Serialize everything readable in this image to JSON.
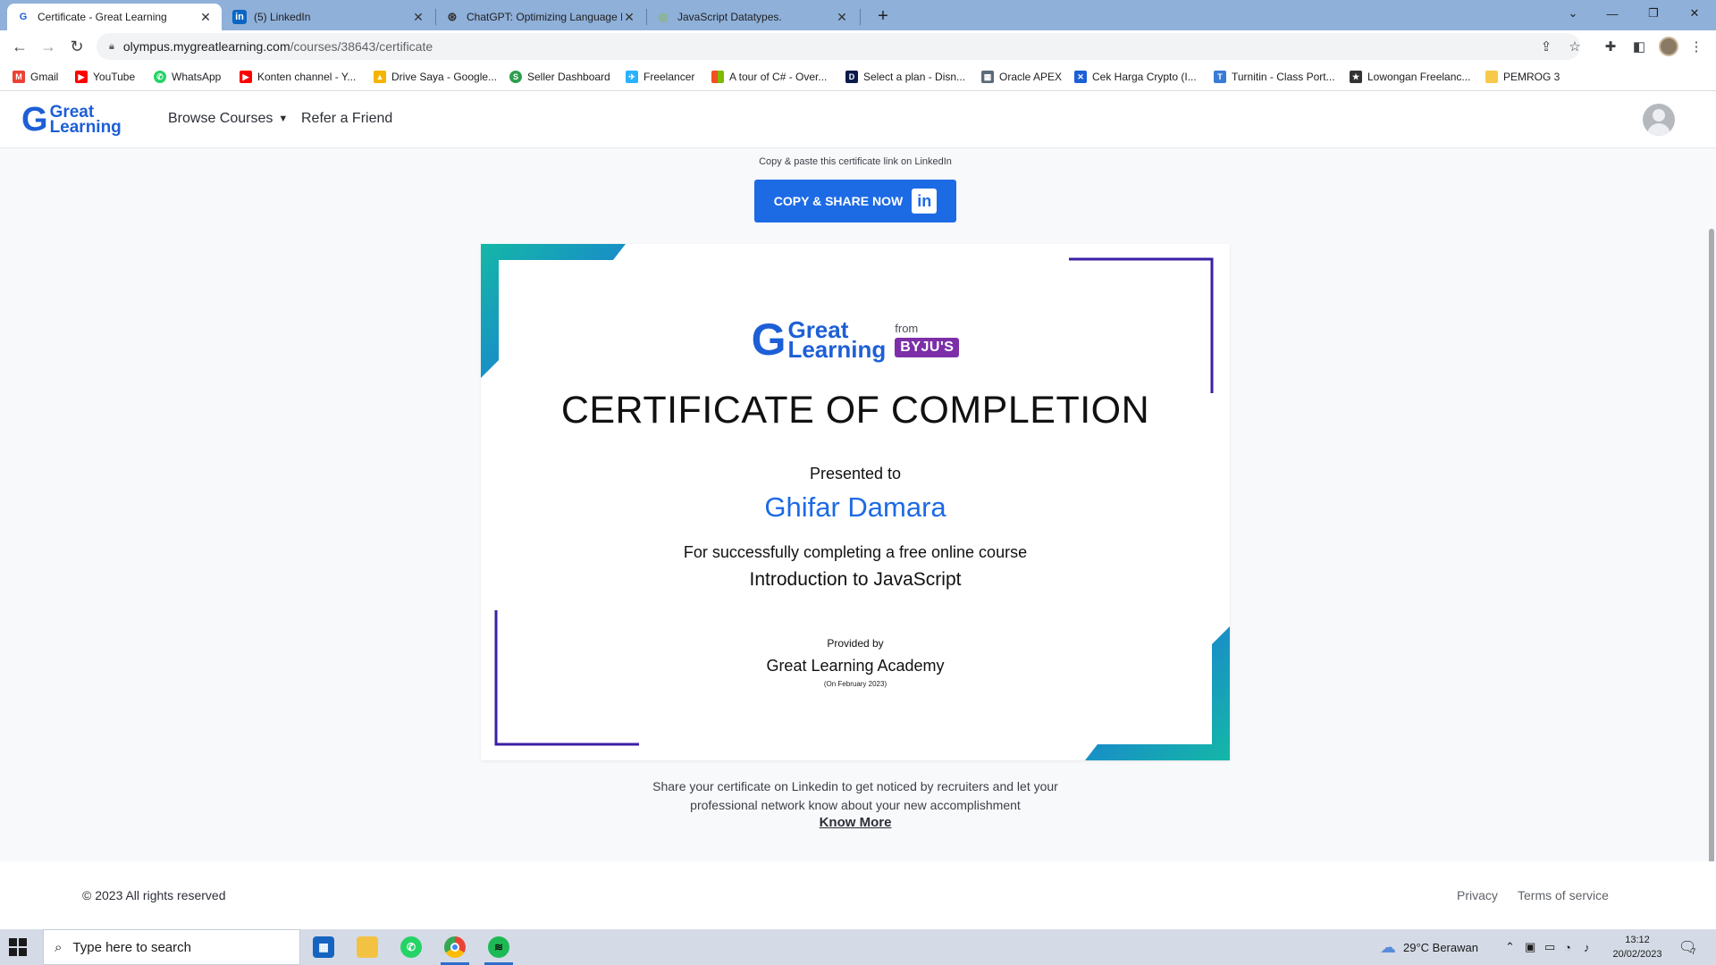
{
  "browser": {
    "tabs": [
      {
        "title": "Certificate - Great Learning",
        "active": true,
        "icon": "great-learning-icon"
      },
      {
        "title": "(5) LinkedIn",
        "active": false,
        "icon": "linkedin-icon"
      },
      {
        "title": "ChatGPT: Optimizing Language M",
        "active": false,
        "icon": "openai-icon"
      },
      {
        "title": "JavaScript Datatypes.",
        "active": false,
        "icon": "globe-icon"
      }
    ],
    "url_host": "olympus.mygreatlearning.com",
    "url_path": "/courses/38643/certificate",
    "bookmarks": [
      {
        "label": "Gmail",
        "icon": "gmail-icon",
        "color": "#ea4335"
      },
      {
        "label": "YouTube",
        "icon": "youtube-icon",
        "color": "#ff0000"
      },
      {
        "label": "WhatsApp",
        "icon": "whatsapp-icon",
        "color": "#25d366"
      },
      {
        "label": "Konten channel - Y...",
        "icon": "youtube-icon",
        "color": "#ff0000"
      },
      {
        "label": "Drive Saya - Google...",
        "icon": "drive-icon",
        "color": "#f4b400"
      },
      {
        "label": "Seller Dashboard",
        "icon": "seller-icon",
        "color": "#2e9e4f"
      },
      {
        "label": "Freelancer",
        "icon": "freelancer-icon",
        "color": "#29b2fe"
      },
      {
        "label": "A tour of C# - Over...",
        "icon": "microsoft-icon",
        "color": "#f25022"
      },
      {
        "label": "Select a plan - Disn...",
        "icon": "disney-icon",
        "color": "#0b1a4a"
      },
      {
        "label": "Oracle APEX",
        "icon": "oracle-icon",
        "color": "#5a6b7a"
      },
      {
        "label": "Cek Harga Crypto (I...",
        "icon": "crypto-icon",
        "color": "#1d5fd6"
      },
      {
        "label": "Turnitin - Class Port...",
        "icon": "turnitin-icon",
        "color": "#3a7bd5"
      },
      {
        "label": "Lowongan Freelanc...",
        "icon": "star-icon",
        "color": "#333333"
      },
      {
        "label": "PEMROG 3",
        "icon": "folder-icon",
        "color": "#f7c94a"
      }
    ]
  },
  "site": {
    "logo_top": "Great",
    "logo_bottom": "Learning",
    "nav": {
      "browse": "Browse Courses",
      "refer": "Refer a Friend"
    }
  },
  "main": {
    "copy_hint": "Copy & paste this certificate link on LinkedIn",
    "share_button": "COPY & SHARE NOW",
    "share_icon_text": "in",
    "share_line1": "Share your certificate on Linkedin to get noticed by recruiters and let your",
    "share_line2": "professional network know about your new accomplishment",
    "know_more": "Know More"
  },
  "certificate": {
    "logo_top": "Great",
    "logo_bottom": "Learning",
    "from": "from",
    "byjus": "BYJU'S",
    "title": "CERTIFICATE OF COMPLETION",
    "presented_to": "Presented to",
    "name": "Ghifar Damara",
    "description": "For successfully completing a free online course",
    "course": "Introduction to JavaScript",
    "provided_by": "Provided by",
    "provider": "Great Learning Academy",
    "date": "(On February 2023)",
    "colors": {
      "accent_teal": "#14b8a6",
      "accent_blue": "#1d6ae5",
      "accent_purple": "#3b1fa3",
      "name_color": "#1d6ae5"
    }
  },
  "footer": {
    "copyright": "© 2023 All rights reserved",
    "privacy": "Privacy",
    "terms": "Terms of service"
  },
  "taskbar": {
    "search_placeholder": "Type here to search",
    "weather": "29°C  Berawan",
    "time": "13:12",
    "date": "20/02/2023",
    "notification_count": "7"
  }
}
